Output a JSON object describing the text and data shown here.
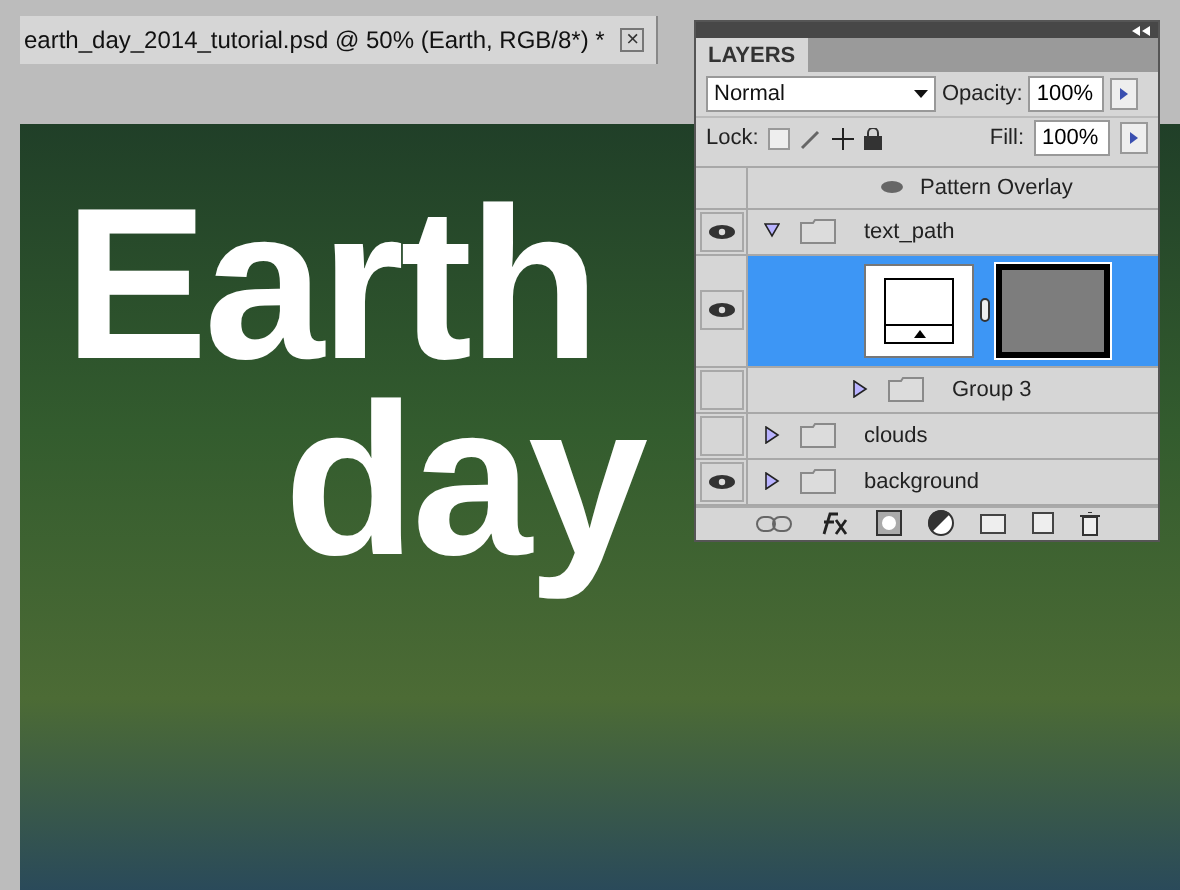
{
  "document_tab": {
    "title": "earth_day_2014_tutorial.psd @ 50% (Earth, RGB/8*) *",
    "close": "×"
  },
  "canvas": {
    "headline": [
      "Earth",
      "day"
    ]
  },
  "layers_panel": {
    "title": "LAYERS",
    "blend_mode": "Normal",
    "opacity_label": "Opacity:",
    "opacity": "100%",
    "lock_label": "Lock:",
    "fill_label": "Fill:",
    "fill": "100%",
    "layers": [
      {
        "kind": "effect",
        "name": "Pattern Overlay",
        "visible": true
      },
      {
        "kind": "group",
        "name": "text_path",
        "visible": true,
        "expanded": true,
        "selected": false,
        "children": [
          {
            "kind": "masked",
            "visible": true,
            "selected": true
          },
          {
            "kind": "group",
            "name": "Group 3",
            "visible": false,
            "expanded": false,
            "selected": false
          }
        ]
      },
      {
        "kind": "group",
        "name": "clouds",
        "visible": false,
        "expanded": false,
        "selected": false
      },
      {
        "kind": "group",
        "name": "background",
        "visible": true,
        "expanded": false,
        "selected": false
      }
    ]
  }
}
